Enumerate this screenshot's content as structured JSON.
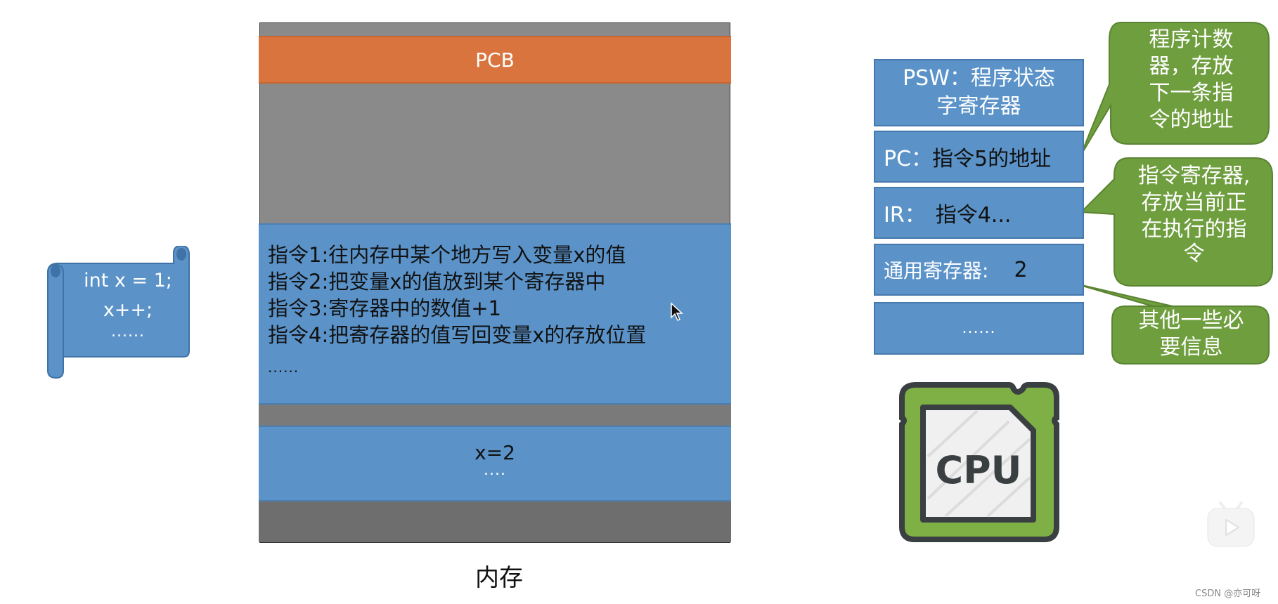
{
  "code_snippet": {
    "lines": [
      "int x = 1;",
      "x++;",
      "......"
    ]
  },
  "memory": {
    "label": "内存",
    "pcb_label": "PCB",
    "instructions": [
      "指令1:往内存中某个地方写入变量x的值",
      "指令2:把变量x的值放到某个寄存器中",
      "指令3:寄存器中的数值+1",
      "指令4:把寄存器的值写回变量x的存放位置",
      "......"
    ],
    "data_block": {
      "value": "x=2",
      "ellipsis": "...."
    }
  },
  "registers": {
    "psw": {
      "line1": "PSW：程序状态",
      "line2": "字寄存器"
    },
    "pc": {
      "name": "PC：",
      "value": "指令5的地址"
    },
    "ir": {
      "name": "IR：",
      "value": "指令4..."
    },
    "gpr": {
      "name": "通用寄存器:",
      "value": "2"
    },
    "more": "......"
  },
  "callouts": {
    "pc": [
      "程序计数",
      "器，存放",
      "下一条指",
      "令的地址"
    ],
    "ir": [
      "指令寄存器,",
      "存放当前正",
      "在执行的指",
      "令"
    ],
    "other": [
      "其他一些必",
      "要信息"
    ]
  },
  "cpu_icon": {
    "label": "CPU"
  },
  "watermark": "CSDN @亦可呀",
  "colors": {
    "memory_gray": "#8a8a8a",
    "pcb_orange": "#d9743e",
    "block_blue": "#5b93c9",
    "callout_green": "#6f9e3f",
    "cpu_green": "#7fb046"
  }
}
